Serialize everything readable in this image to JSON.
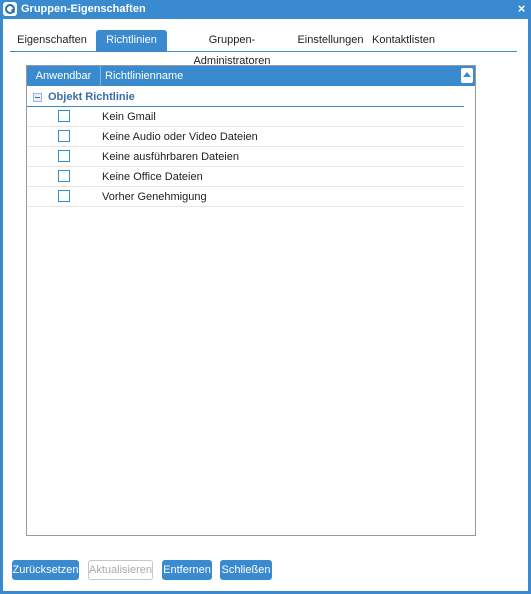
{
  "window": {
    "title": "Gruppen-Eigenschaften",
    "close_glyph": "×"
  },
  "tabs": [
    {
      "label": "Eigenschaften",
      "active": false
    },
    {
      "label": "Richtlinien",
      "active": true
    },
    {
      "label": "Gruppen-Administratoren",
      "active": false
    },
    {
      "label": "Einstellungen",
      "active": false
    },
    {
      "label": "Kontaktlisten",
      "active": false
    }
  ],
  "grid": {
    "columns": [
      "Anwendbar",
      "Richtlinienname"
    ],
    "group": {
      "label": "Objekt Richtlinie",
      "expanded": true
    },
    "rows": [
      {
        "name": "Kein Gmail",
        "checked": false
      },
      {
        "name": "Keine Audio oder Video Dateien",
        "checked": false
      },
      {
        "name": "Keine ausführbaren Dateien",
        "checked": false
      },
      {
        "name": "Keine Office Dateien",
        "checked": false
      },
      {
        "name": "Vorher Genehmigung",
        "checked": false
      }
    ]
  },
  "buttons": {
    "reset": "Zurücksetzen",
    "update": "Aktualisieren",
    "remove": "Entfernen",
    "close": "Schließen"
  },
  "colors": {
    "accent": "#3a8ad0",
    "group_text": "#3a6da8"
  },
  "icons": {
    "app": "app-logo-icon",
    "close": "close-icon",
    "sort": "sort-up-icon",
    "collapse": "collapse-icon"
  }
}
